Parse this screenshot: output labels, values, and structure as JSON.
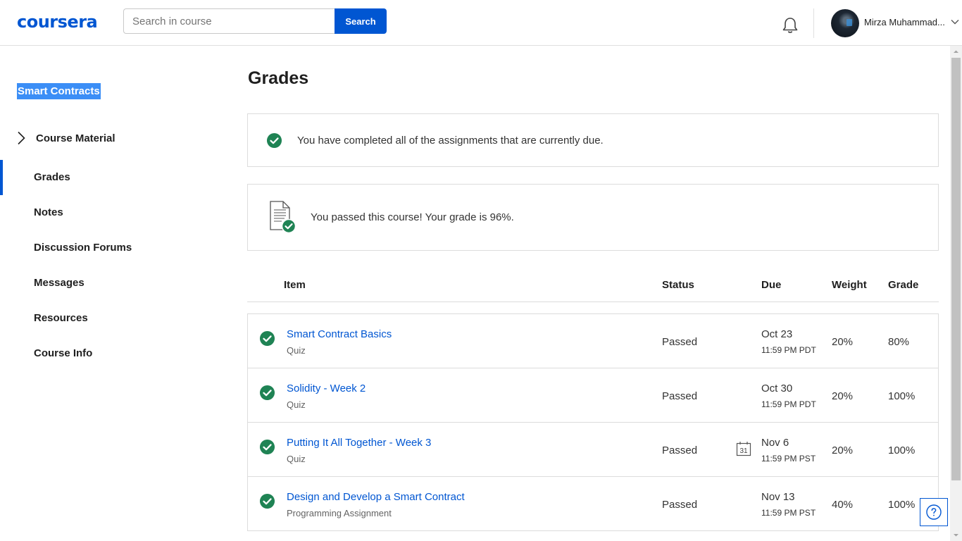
{
  "header": {
    "logo": "coursera",
    "search_placeholder": "Search in course",
    "search_button": "Search",
    "user_name": "Mirza Muhammad..."
  },
  "sidebar": {
    "course_title": "Smart Contracts",
    "course_material": "Course Material",
    "items": [
      {
        "label": "Grades",
        "active": true
      },
      {
        "label": "Notes"
      },
      {
        "label": "Discussion Forums"
      },
      {
        "label": "Messages"
      },
      {
        "label": "Resources"
      },
      {
        "label": "Course Info"
      }
    ]
  },
  "main": {
    "title": "Grades",
    "completed_message": "You have completed all of the assignments that are currently due.",
    "passed_message": "You passed this course! Your grade is 96%.",
    "table": {
      "headers": {
        "item": "Item",
        "status": "Status",
        "due": "Due",
        "weight": "Weight",
        "grade": "Grade"
      },
      "rows": [
        {
          "title": "Smart Contract Basics",
          "type": "Quiz",
          "status": "Passed",
          "due_date": "Oct 23",
          "due_time": "11:59 PM PDT",
          "weight": "20%",
          "grade": "80%"
        },
        {
          "title": "Solidity - Week 2",
          "type": "Quiz",
          "status": "Passed",
          "due_date": "Oct 30",
          "due_time": "11:59 PM PDT",
          "weight": "20%",
          "grade": "100%"
        },
        {
          "title": "Putting It All Together - Week 3",
          "type": "Quiz",
          "status": "Passed",
          "due_date": "Nov 6",
          "due_time": "11:59 PM PST",
          "weight": "20%",
          "grade": "100%",
          "calendar_day": "31"
        },
        {
          "title": "Design and Develop a Smart Contract",
          "type": "Programming Assignment",
          "status": "Passed",
          "due_date": "Nov 13",
          "due_time": "11:59 PM PST",
          "weight": "40%",
          "grade": "100%"
        }
      ]
    }
  },
  "colors": {
    "brand": "#0056d2",
    "success": "#1f8354",
    "selection": "#3b8ef6"
  },
  "icons": [
    "bell-icon",
    "chevron-down-icon",
    "chevron-right-icon",
    "check-circle-icon",
    "document-check-icon",
    "calendar-icon",
    "help-icon"
  ]
}
